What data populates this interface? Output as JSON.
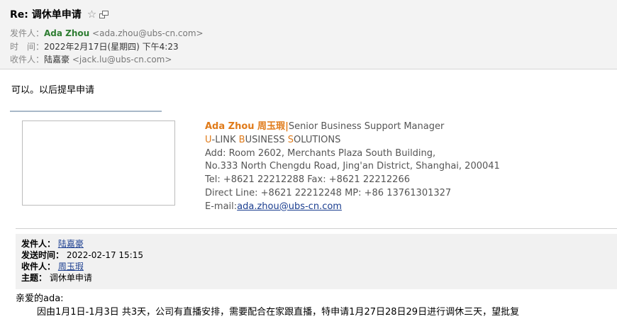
{
  "header": {
    "subject": "Re: 调休单申请",
    "from_label": "发件人：",
    "from_name": "Ada Zhou",
    "from_addr": "<ada.zhou@ubs-cn.com>",
    "time_label": "时　间：",
    "time_value": "2022年2月17日(星期四) 下午4:23",
    "to_label": "收件人：",
    "to_name": "陆嘉豪",
    "to_addr": "<jack.lu@ubs-cn.com>"
  },
  "reply_text": "可以。以后提早申请",
  "signature": {
    "name": "Ada Zhou 周玉瑕",
    "sep": "|",
    "title": "Senior Business Support Manager",
    "company_u": "U",
    "company_rest1": "-LINK ",
    "company_b": "B",
    "company_rest2": "USINESS ",
    "company_s": "S",
    "company_rest3": "OLUTIONS",
    "addr1": "Add: Room 2602, Merchants Plaza South Building,",
    "addr2": "No.333 North Chengdu Road, Jing'an District, Shanghai, 200041",
    "tel": "Tel: +8621 22212288  Fax: +8621 22212266",
    "direct": "Direct Line: +8621 22212248   MP: +86 13761301327",
    "email_label": "E-mail:",
    "email": "ada.zhou@ubs-cn.com"
  },
  "quote": {
    "from_label": "发件人：",
    "from_value": "陆嘉豪",
    "sent_label": "发送时间：",
    "sent_value": "2022-02-17 15:15",
    "to_label": "收件人：",
    "to_value": "周玉瑕",
    "subject_label": "主题：",
    "subject_value": "调休单申请"
  },
  "body": {
    "greeting": "亲爱的ada:",
    "content": "因由1月1日-1月3日 共3天，公司有直播安排，需要配合在家跟直播，特申请1月27日28日29日进行调休三天，望批复"
  }
}
